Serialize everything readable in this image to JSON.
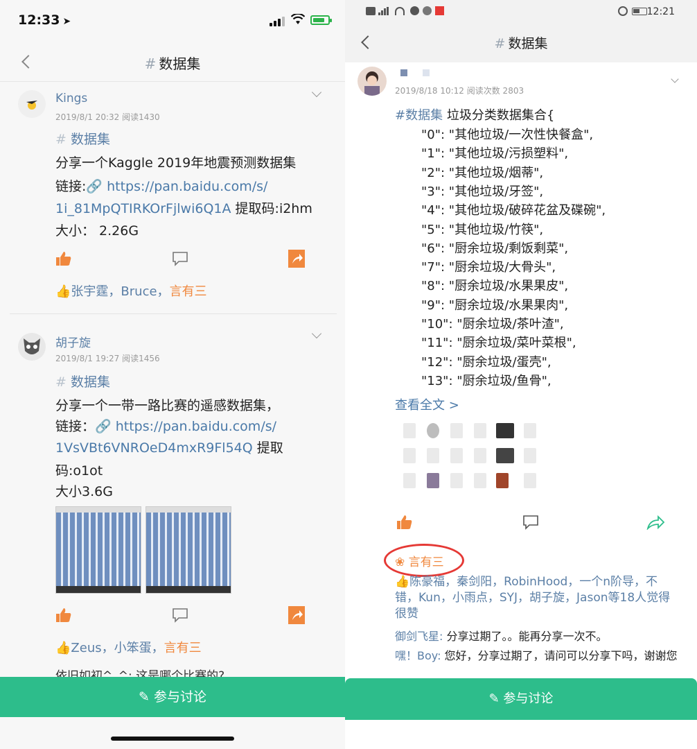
{
  "left": {
    "status": {
      "time": "12:33"
    },
    "nav": {
      "title": "数据集"
    },
    "posts": [
      {
        "author": "Kings",
        "meta": "2019/8/1 20:32   阅读1430",
        "tag": "数据集",
        "lines": [
          "分享一个Kaggle 2019年地震预测数据集"
        ],
        "link_prefix": "链接:",
        "link1": "https://pan.baidu.com/s/",
        "link2": "1i_81MpQTIRKOrFjlwi6Q1A",
        "code": " 提取码:i2hm",
        "size": "大小： 2.26G",
        "likes_a": "张宇霆，Bruce，",
        "likes_b": "言有三"
      },
      {
        "author": "胡子旋",
        "meta": "2019/8/1 19:27   阅读1456",
        "tag": "数据集",
        "lines": [
          "分享一个一带一路比赛的遥感数据集，"
        ],
        "link_prefix": "链接：",
        "link1": "https://pan.baidu.com/s/",
        "link2": "1VsVBt6VNROeD4mxR9Fl54Q",
        "code": " 提取",
        "code2": "码:o1ot",
        "size": "大小3.6G",
        "likes_a": "Zeus，小笨蛋，",
        "likes_b": "言有三",
        "next_comment": "依旧如初^_^: 这是哪个比赛的?"
      }
    ],
    "bottom_button": "参与讨论"
  },
  "right": {
    "status": {
      "time": "12:21"
    },
    "nav": {
      "title": "数据集"
    },
    "meta": "2019/8/18 10:12   阅读次数 2803",
    "tag": "#数据集",
    "heading": "垃圾分类数据集合{",
    "items": [
      "\"0\": \"其他垃圾/一次性快餐盒\",",
      "\"1\": \"其他垃圾/污损塑料\",",
      "\"2\": \"其他垃圾/烟蒂\",",
      "\"3\": \"其他垃圾/牙签\",",
      "\"4\": \"其他垃圾/破碎花盆及碟碗\",",
      "\"5\": \"其他垃圾/竹筷\",",
      "\"6\": \"厨余垃圾/剩饭剩菜\",",
      "\"7\": \"厨余垃圾/大骨头\",",
      "\"8\": \"厨余垃圾/水果果皮\",",
      "\"9\": \"厨余垃圾/水果果肉\",",
      "\"10\": \"厨余垃圾/茶叶渣\",",
      "\"11\": \"厨余垃圾/菜叶菜根\",",
      "\"12\": \"厨余垃圾/蛋壳\",",
      "\"13\": \"厨余垃圾/鱼骨\","
    ],
    "read_more": "查看全文 >",
    "highlighted_user": "言有三",
    "likes_text": "陈豪福，秦剑阳，RobinHood，一个n阶导，不错，Kun，小雨点，SYJ，胡子旋，Jason等18人觉得很赞",
    "comments": [
      {
        "name": "御剑飞星:",
        "text": " 分享过期了。。能再分享一次不。"
      },
      {
        "name": "嘿！Boy:",
        "text": " 您好，分享过期了，请问可以分享下吗，谢谢您"
      }
    ],
    "bottom_button": "参与讨论"
  },
  "colors": {
    "accent_green": "#2dbd8b",
    "link_blue": "#4a79a8",
    "orange": "#f0883e",
    "highlight_red": "#e53935"
  }
}
